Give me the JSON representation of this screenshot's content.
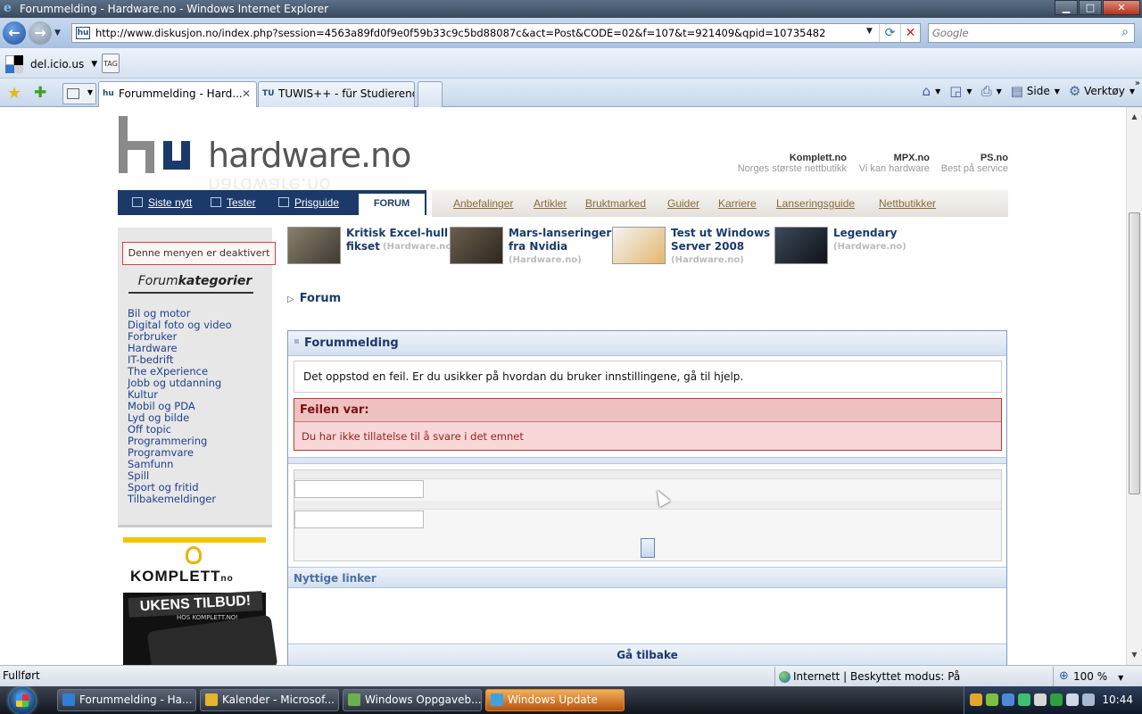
{
  "window": {
    "title": "Forummelding - Hardware.no - Windows Internet Explorer",
    "controls": [
      "minimize",
      "maximize",
      "close"
    ]
  },
  "addressbar": {
    "url": "http://www.diskusjon.no/index.php?session=4563a89fd0f9e0f59b33c9c5bd88087c&act=Post&CODE=02&f=107&t=921409&qpid=10735482",
    "search_placeholder": "Google"
  },
  "linksbar": {
    "delicious_label": "del.icio.us",
    "tag_label": "TAG"
  },
  "tabs": [
    {
      "label": "Forummelding - Hard...",
      "active": true
    },
    {
      "label": "TUWIS++ - für Studierende",
      "active": false
    }
  ],
  "commandbar": {
    "side_label": "Side",
    "verktoy_label": "Verktøy"
  },
  "site": {
    "logo_text": "hardware.no",
    "partners": [
      {
        "name": "Komplett.no",
        "tagline": "Norges største nettbutikk"
      },
      {
        "name": "MPX.no",
        "tagline": "Vi kan hardware"
      },
      {
        "name": "PS.no",
        "tagline": "Best på service"
      }
    ],
    "nav_primary": [
      "Siste nytt",
      "Tester",
      "Prisguide"
    ],
    "nav_active": "FORUM",
    "nav_secondary": [
      "Anbefalinger",
      "Artikler",
      "Bruktmarked",
      "Guider",
      "Karriere",
      "Lanseringsguide",
      "Nettbutikker"
    ]
  },
  "sidebar": {
    "deactivated_notice": "Denne menyen er deaktivert",
    "heading_prefix": "Forum",
    "heading_suffix": "kategorier",
    "categories": [
      "Bil og motor",
      "Digital foto og video",
      "Forbruker",
      "Hardware",
      "IT-bedrift",
      "The eXperience",
      "Jobb og utdanning",
      "Kultur",
      "Mobil og PDA",
      "Lyd og bilde",
      "Off topic",
      "Programmering",
      "Programvare",
      "Samfunn",
      "Spill",
      "Sport og fritid",
      "Tilbakemeldinger"
    ],
    "ad": {
      "brand": "KOMPLETT",
      "brand_suffix": "no",
      "headline": "UKENS TILBUD!",
      "subline": "HOS KOMPLETT.NO!"
    }
  },
  "news": [
    {
      "title": "Kritisk Excel-hull fikset",
      "source": "(Hardware.no)"
    },
    {
      "title": "Mars-lanseringer fra Nvidia",
      "source": "(Hardware.no)"
    },
    {
      "title": "Test ut Windows Server 2008",
      "source": "(Hardware.no)"
    },
    {
      "title": "Legendary",
      "source": "(Hardware.no)"
    }
  ],
  "breadcrumb": "Forum",
  "forum_message": {
    "title": "Forummelding",
    "info": "Det oppstod en feil. Er du usikker på hvordan du bruker innstillingene, gå til hjelp.",
    "error_heading": "Feilen var:",
    "error_text": "Du har ikke tillatelse til å svare i det emnet",
    "useful_links_heading": "Nyttige linker",
    "back_label": "Gå tilbake"
  },
  "statusbar": {
    "status": "Fullført",
    "zone": "Internett | Beskyttet modus: På",
    "zoom": "100 %"
  },
  "taskbar": {
    "items": [
      {
        "label": "Forummelding - Ha...",
        "active": false
      },
      {
        "label": "Kalender - Microsof...",
        "active": false
      },
      {
        "label": "Windows Oppgaveb...",
        "active": false
      },
      {
        "label": "Windows Update",
        "active": true
      }
    ],
    "clock": "10:44"
  }
}
